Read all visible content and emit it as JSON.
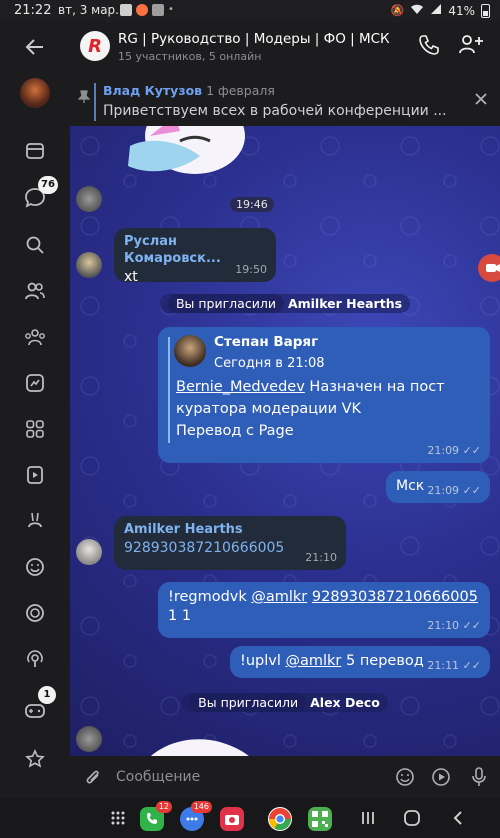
{
  "status": {
    "time": "21:22",
    "date": "вт, 3 мар.",
    "battery": "41%"
  },
  "rail": {
    "messages_badge": "76",
    "games_badge": "1"
  },
  "header": {
    "title": "RG | Руководство | Модеры | ФО | МСК",
    "subtitle": "15 участников, 5 онлайн"
  },
  "pinned": {
    "author": "Влад Кутузов",
    "date": "1 февраля",
    "text": "Приветствуем всех в рабочей конференции ..."
  },
  "messages": [
    {
      "time": "19:46"
    },
    {
      "author": "Руслан Комаровск...",
      "text": "xt",
      "time": "19:50"
    },
    {
      "prefix": "Вы пригласили",
      "name": "Amilker Hearths"
    },
    {
      "fwd_author": "Степан Варяг",
      "fwd_date": "Сегодня в 21:08",
      "link": "Bernie_Medvedev",
      "line1": " Назначен на пост",
      "line2": "куратора модерации VK",
      "line3": "Перевод с Page",
      "time": "21:09"
    },
    {
      "text": "Мск",
      "time": "21:09"
    },
    {
      "author": "Amilker Hearths",
      "text": "928930387210666005",
      "time": "21:10"
    },
    {
      "part1": "!regmodvk ",
      "mention": "@amlkr",
      "id": "928930387210666005",
      "line2": "1 1",
      "time": "21:10"
    },
    {
      "part1": "!uplvl ",
      "mention": "@amlkr",
      "part2": " 5 перевод",
      "time": "21:11"
    },
    {
      "prefix": "Вы пригласили",
      "name": "Alex Deco"
    }
  ],
  "input": {
    "placeholder": "Сообщение"
  },
  "navbar": {
    "phone_badge": "12",
    "chat_badge": "146"
  }
}
